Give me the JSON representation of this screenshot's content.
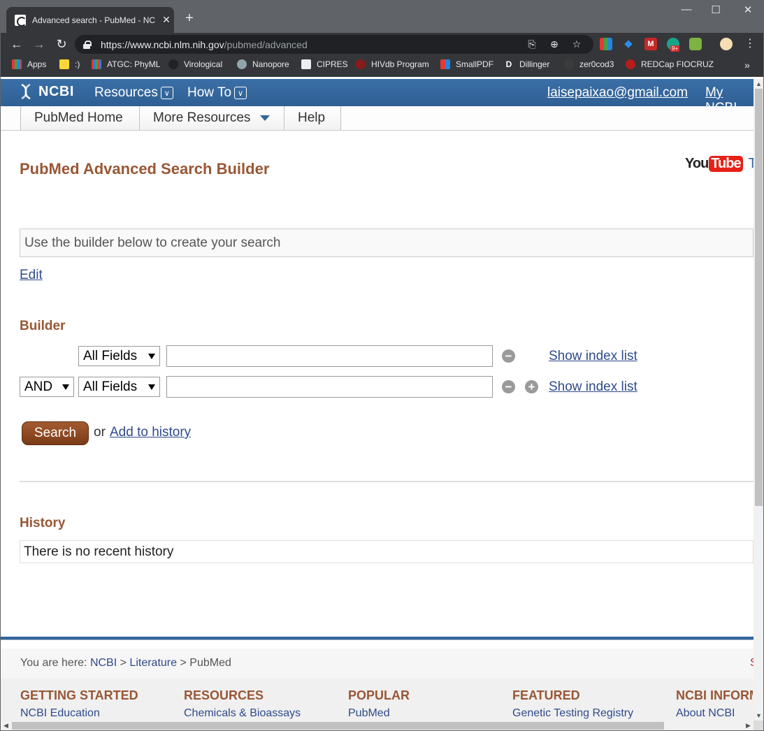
{
  "browser": {
    "tab_title": "Advanced search - PubMed - NC",
    "url_host": "https://www.ncbi.nlm.nih.gov",
    "url_path": "/pubmed/advanced",
    "bookmarks": [
      "Apps",
      ":)",
      "ATGC: PhyML",
      "Virological",
      "Nanopore",
      "CIPRES",
      "HIVdb Program",
      "SmallPDF",
      "Dillinger",
      "zer0cod3",
      "REDCap FIOCRUZ"
    ],
    "more": "»",
    "badge": "9+"
  },
  "ncbi": {
    "logo": "NCBI",
    "resources": "Resources",
    "howto": "How To",
    "user": "laisepaixao@gmail.com",
    "my_ncbi": "My NCBI"
  },
  "subnav": {
    "home": "PubMed Home",
    "more": "More Resources",
    "help": "Help"
  },
  "main": {
    "title": "PubMed Advanced Search Builder",
    "youtube_you": "You",
    "youtube_tube": "Tube",
    "youtube_tu": "Tu",
    "query_placeholder": "Use the builder below to create your search",
    "edit": "Edit",
    "builder_heading": "Builder",
    "row1_field": "All Fields",
    "row2_op": "AND",
    "row2_field": "All Fields",
    "show_index": "Show index list",
    "search_button": "Search",
    "or": "or",
    "add_history": "Add to history",
    "history_heading": "History",
    "history_empty": "There is no recent history"
  },
  "footer": {
    "you_are_here": "You are here:",
    "bc_ncbi": "NCBI",
    "bc_lit": "Literature",
    "bc_pubmed": "PubMed",
    "sep": ">",
    "support_s": "S",
    "cols": [
      {
        "heading": "GETTING STARTED",
        "link": "NCBI Education"
      },
      {
        "heading": "RESOURCES",
        "link": "Chemicals & Bioassays"
      },
      {
        "heading": "POPULAR",
        "link": "PubMed"
      },
      {
        "heading": "FEATURED",
        "link": "Genetic Testing Registry"
      },
      {
        "heading": "NCBI INFORM",
        "link": "About NCBI"
      }
    ]
  },
  "colors": {
    "ncbi_blue": "#336699",
    "heading_brown": "#985735",
    "link_blue": "#2f4a8a"
  }
}
